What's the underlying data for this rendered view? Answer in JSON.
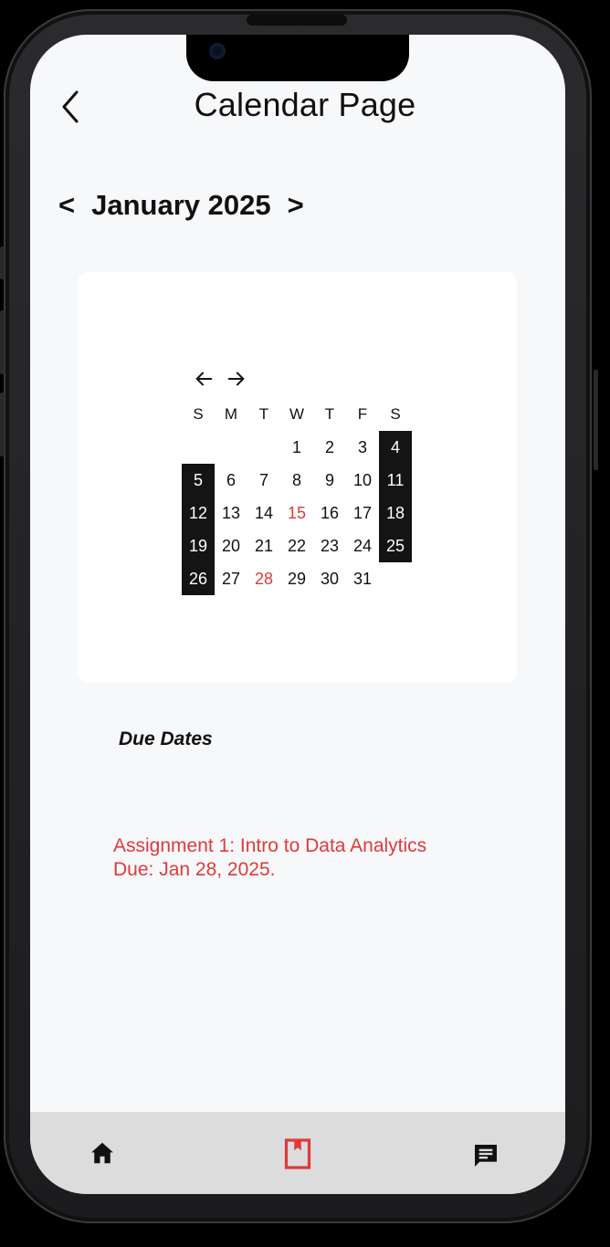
{
  "header": {
    "title": "Calendar Page"
  },
  "month_nav": {
    "prev": "<",
    "label": "January 2025",
    "next": ">"
  },
  "calendar": {
    "weekdays": [
      "S",
      "M",
      "T",
      "W",
      "T",
      "F",
      "S"
    ],
    "days": [
      "",
      "",
      "",
      "1",
      "2",
      "3",
      "4",
      "5",
      "6",
      "7",
      "8",
      "9",
      "10",
      "11",
      "12",
      "13",
      "14",
      "15",
      "16",
      "17",
      "18",
      "19",
      "20",
      "21",
      "22",
      "23",
      "24",
      "25",
      "26",
      "27",
      "28",
      "29",
      "30",
      "31",
      ""
    ],
    "highlighted_days": [
      "15",
      "28"
    ],
    "highlight_color": "#e03a3a",
    "weekend_fill": "#141414"
  },
  "due_dates": {
    "title": "Due Dates",
    "line1": "Assignment 1: Intro to Data Analytics",
    "line2": "Due: Jan 28, 2025."
  },
  "bottom_nav": {
    "items": [
      {
        "icon": "home-icon"
      },
      {
        "icon": "bookmark-icon",
        "active": true
      },
      {
        "icon": "message-icon"
      }
    ],
    "active_color": "#e03a3a"
  }
}
